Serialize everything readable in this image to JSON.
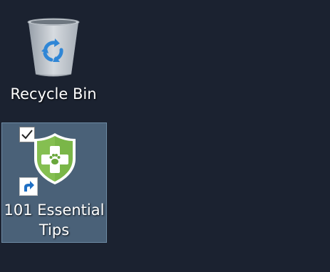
{
  "desktop": {
    "background_color": "#1b2230",
    "icons": [
      {
        "label": "Recycle Bin",
        "icon": "recycle-bin-icon",
        "selected": false
      },
      {
        "label_line1": "101 Essential",
        "label_line2": "Tips",
        "icon": "green-shield-cross-icon",
        "shortcut": true,
        "checked": true,
        "selected": true,
        "selection_color": "#4a6178",
        "shield_color": "#7ab648"
      }
    ]
  }
}
